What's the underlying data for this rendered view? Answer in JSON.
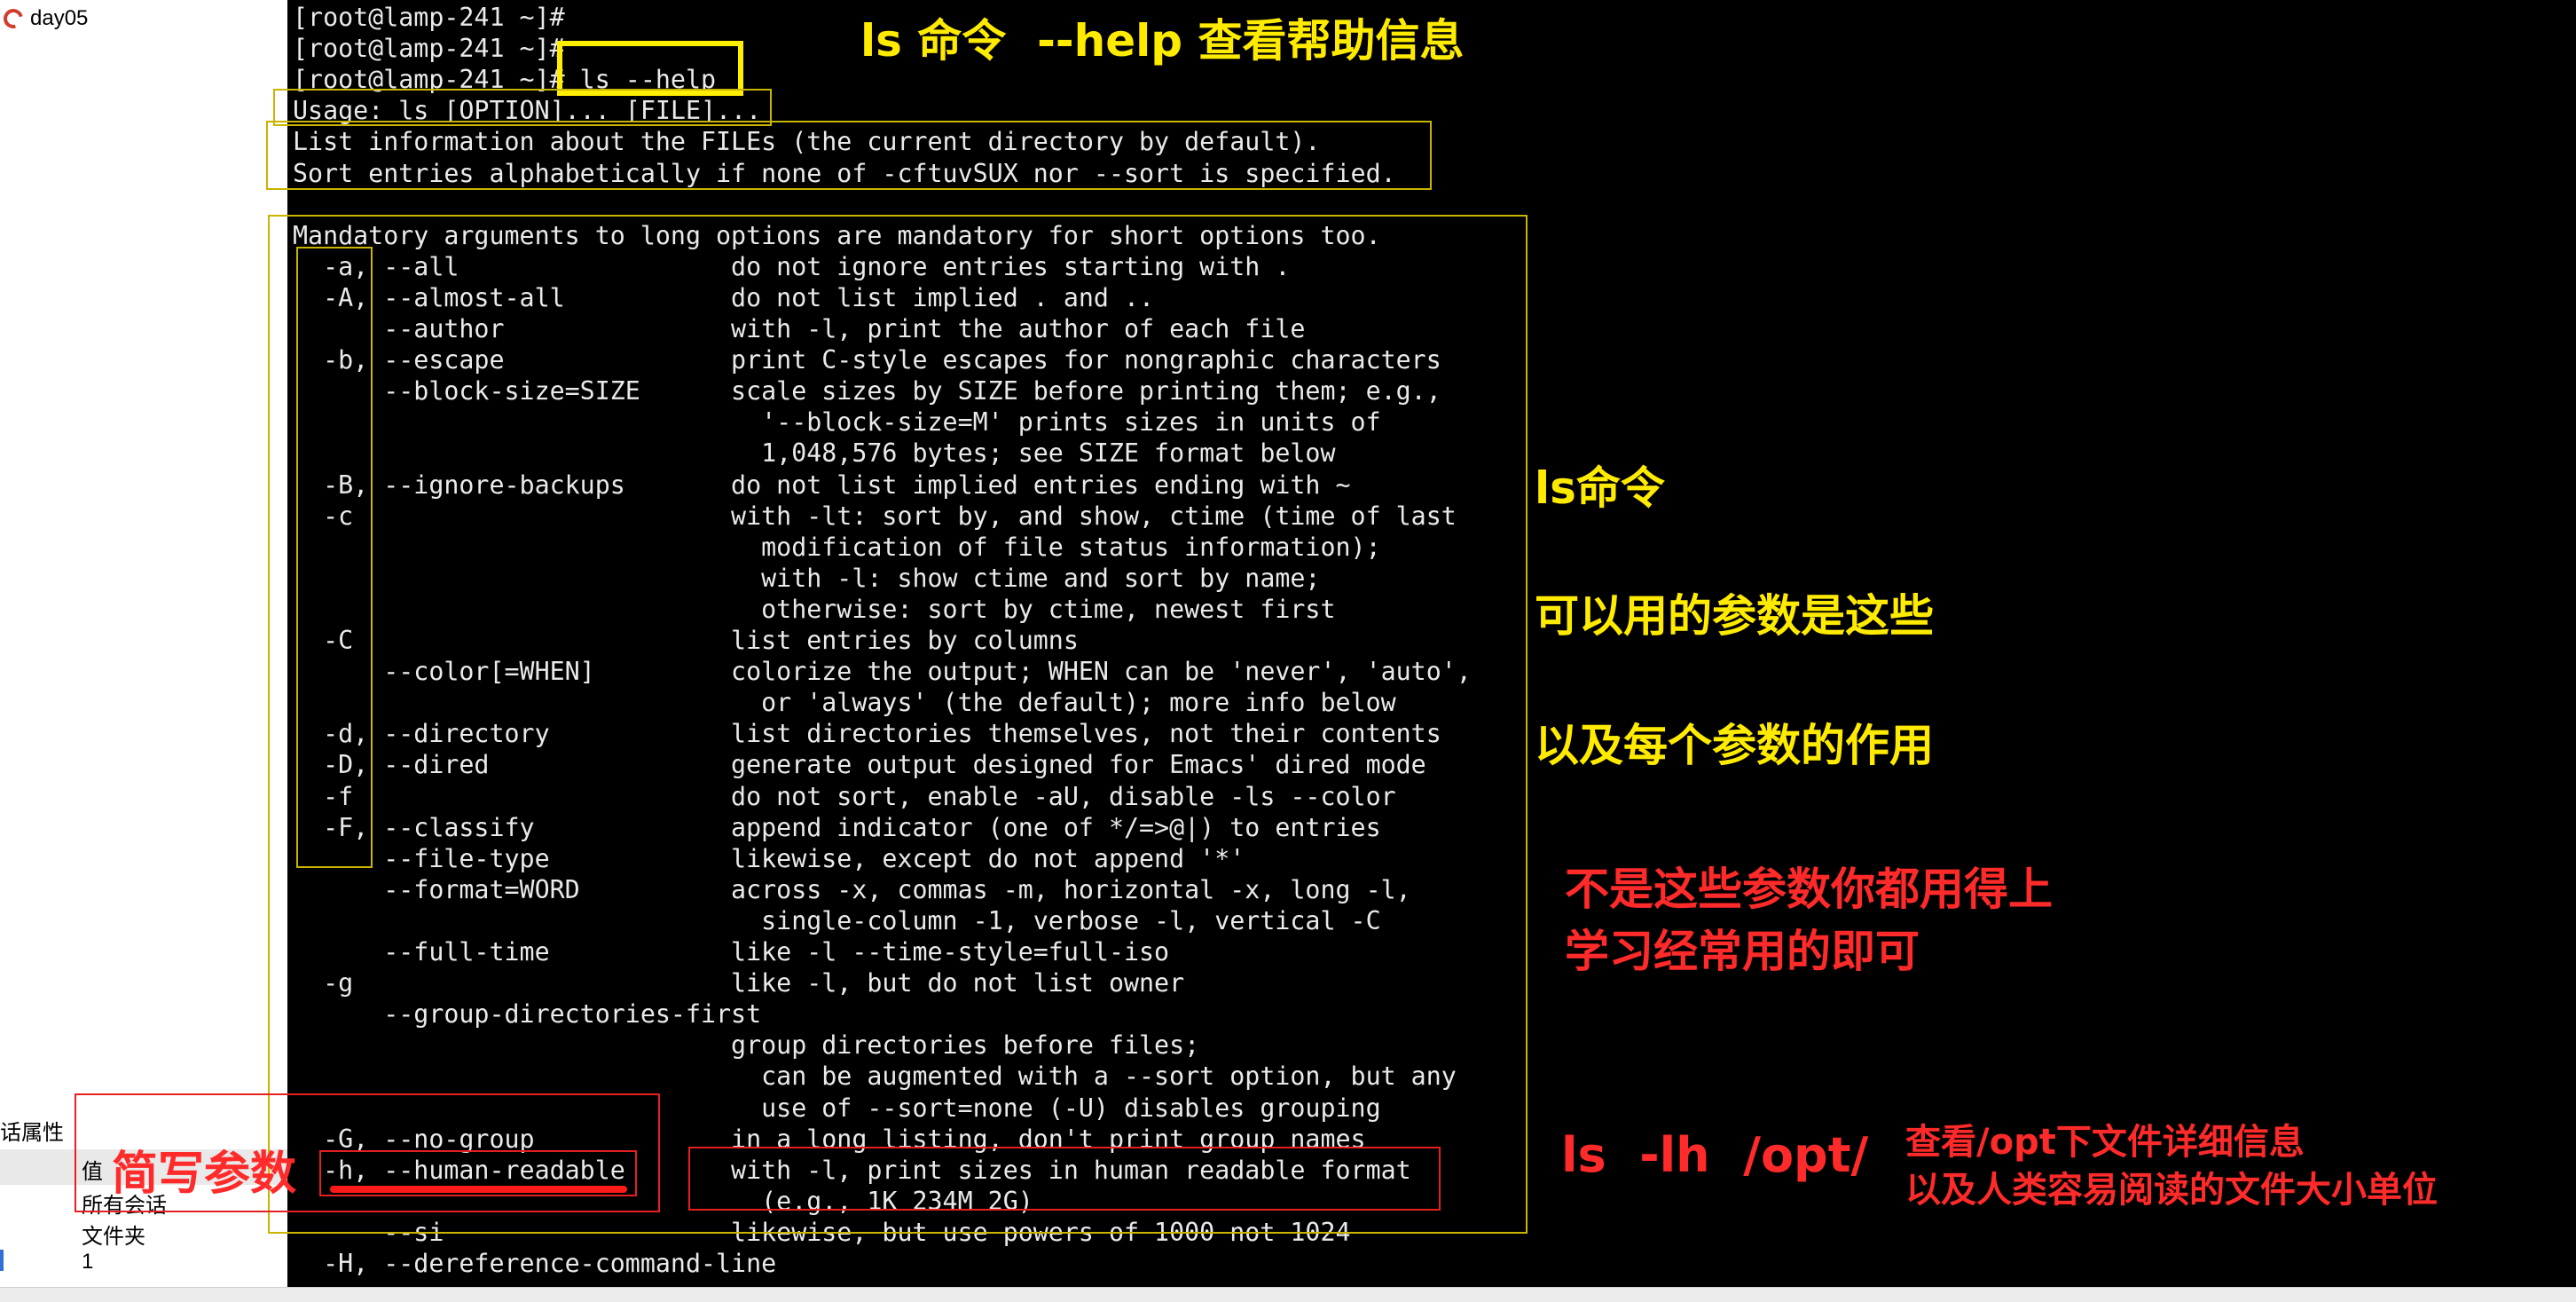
{
  "left_panel": {
    "session_name": "day05",
    "properties_title": "话属性",
    "value_label": "值",
    "rows": [
      "所有会话",
      "文件夹",
      "1"
    ]
  },
  "terminal": {
    "lines": [
      "[root@lamp-241 ~]#",
      "[root@lamp-241 ~]#",
      "[root@lamp-241 ~]# ls --help",
      "Usage: ls [OPTION]... [FILE]...",
      "List information about the FILEs (the current directory by default).",
      "Sort entries alphabetically if none of -cftuvSUX nor --sort is specified.",
      "",
      "Mandatory arguments to long options are mandatory for short options too.",
      "  -a, --all                  do not ignore entries starting with .",
      "  -A, --almost-all           do not list implied . and ..",
      "      --author               with -l, print the author of each file",
      "  -b, --escape               print C-style escapes for nongraphic characters",
      "      --block-size=SIZE      scale sizes by SIZE before printing them; e.g.,",
      "                               '--block-size=M' prints sizes in units of",
      "                               1,048,576 bytes; see SIZE format below",
      "  -B, --ignore-backups       do not list implied entries ending with ~",
      "  -c                         with -lt: sort by, and show, ctime (time of last",
      "                               modification of file status information);",
      "                               with -l: show ctime and sort by name;",
      "                               otherwise: sort by ctime, newest first",
      "  -C                         list entries by columns",
      "      --color[=WHEN]         colorize the output; WHEN can be 'never', 'auto',",
      "                               or 'always' (the default); more info below",
      "  -d, --directory            list directories themselves, not their contents",
      "  -D, --dired                generate output designed for Emacs' dired mode",
      "  -f                         do not sort, enable -aU, disable -ls --color",
      "  -F, --classify             append indicator (one of */=>@|) to entries",
      "      --file-type            likewise, except do not append '*'",
      "      --format=WORD          across -x, commas -m, horizontal -x, long -l,",
      "                               single-column -1, verbose -l, vertical -C",
      "      --full-time            like -l --time-style=full-iso",
      "  -g                         like -l, but do not list owner",
      "      --group-directories-first",
      "                             group directories before files;",
      "                               can be augmented with a --sort option, but any",
      "                               use of --sort=none (-U) disables grouping",
      "  -G, --no-group             in a long listing, don't print group names",
      "  -h, --human-readable       with -l, print sizes in human readable format",
      "                               (e.g., 1K 234M 2G)",
      "      --si                   likewise, but use powers of 1000 not 1024",
      "  -H, --dereference-command-line"
    ]
  },
  "annotations": {
    "title": "ls 命令  --help 查看帮助信息",
    "ls_cmd": "ls命令",
    "params_available": "可以用的参数是这些",
    "params_effect": "以及每个参数的作用",
    "not_all_line1": "不是这些参数你都用得上",
    "not_all_line2": "学习经常用的即可",
    "short_params": "简写参数",
    "example_cmd": "ls  -lh  /opt/",
    "example_desc1": "查看/opt下文件详细信息",
    "example_desc2": "以及人类容易阅读的文件大小单位"
  },
  "colors": {
    "terminal_bg": "#000000",
    "terminal_fg": "#eaeaea",
    "annotation_yellow": "#ffeb00",
    "annotation_red": "#ff2a2a"
  }
}
